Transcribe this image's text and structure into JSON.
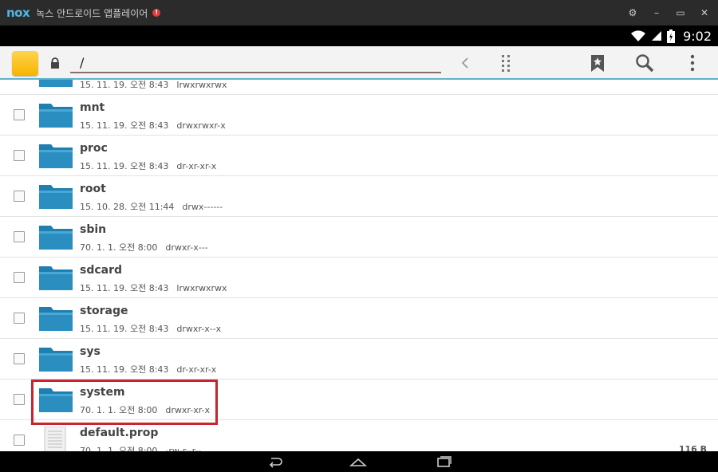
{
  "window": {
    "logo": "nox",
    "title": "녹스 안드로이드 앱플레이어",
    "notification": "!",
    "controls": [
      "⚙",
      "–",
      "▭",
      "✕"
    ]
  },
  "status": {
    "time": "9:02",
    "icons": [
      "wifi-icon",
      "signal-icon",
      "battery-icon"
    ]
  },
  "toolbar": {
    "path": "/",
    "icons": [
      "back-icon",
      "grid-dots-icon",
      "bookmark-icon",
      "search-icon",
      "more-icon"
    ]
  },
  "files": [
    {
      "name": "",
      "date": "15. 11. 19. 오전 8:43",
      "perm": "lrwxrwxrwx",
      "type": "folder",
      "size": ""
    },
    {
      "name": "mnt",
      "date": "15. 11. 19. 오전 8:43",
      "perm": "drwxrwxr-x",
      "type": "folder",
      "size": ""
    },
    {
      "name": "proc",
      "date": "15. 11. 19. 오전 8:43",
      "perm": "dr-xr-xr-x",
      "type": "folder",
      "size": ""
    },
    {
      "name": "root",
      "date": "15. 10. 28. 오전 11:44",
      "perm": "drwx------",
      "type": "folder",
      "size": ""
    },
    {
      "name": "sbin",
      "date": "70. 1. 1. 오전 8:00",
      "perm": "drwxr-x---",
      "type": "folder",
      "size": ""
    },
    {
      "name": "sdcard",
      "date": "15. 11. 19. 오전 8:43",
      "perm": "lrwxrwxrwx",
      "type": "folder",
      "size": ""
    },
    {
      "name": "storage",
      "date": "15. 11. 19. 오전 8:43",
      "perm": "drwxr-x--x",
      "type": "folder",
      "size": ""
    },
    {
      "name": "sys",
      "date": "15. 11. 19. 오전 8:43",
      "perm": "dr-xr-xr-x",
      "type": "folder",
      "size": ""
    },
    {
      "name": "system",
      "date": "70. 1. 1. 오전 8:00",
      "perm": "drwxr-xr-x",
      "type": "folder",
      "size": ""
    },
    {
      "name": "default.prop",
      "date": "70. 1. 1. 오전 8:00",
      "perm": "-rw-r--r--",
      "type": "file",
      "size": "116 B"
    }
  ],
  "highlighted_item": "system",
  "colors": {
    "accent": "#5fb3c8",
    "folder": "#2a8fc0",
    "highlight": "#c9242b"
  }
}
